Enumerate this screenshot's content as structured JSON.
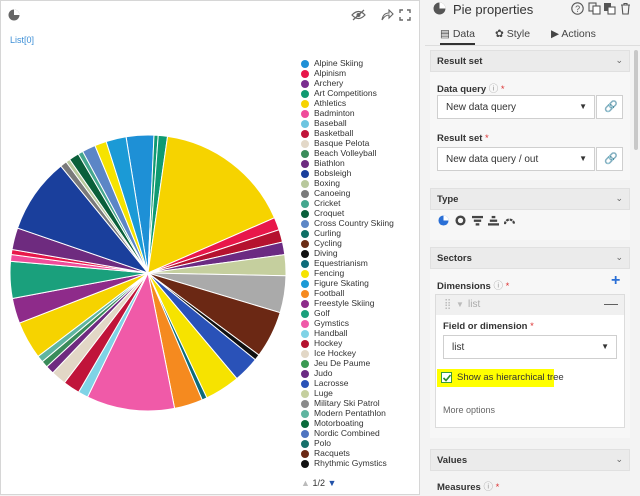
{
  "chart": {
    "list_label": "List[0]",
    "legend": [
      {
        "label": "Alpine Skiing",
        "color": "#1e90d6"
      },
      {
        "label": "Alpinism",
        "color": "#e8174a"
      },
      {
        "label": "Archery",
        "color": "#7b2d8f"
      },
      {
        "label": "Art Competitions",
        "color": "#0f9a72"
      },
      {
        "label": "Athletics",
        "color": "#f6d300"
      },
      {
        "label": "Badminton",
        "color": "#f04c9a"
      },
      {
        "label": "Baseball",
        "color": "#6cc5e0"
      },
      {
        "label": "Basketball",
        "color": "#c0143a"
      },
      {
        "label": "Basque Pelota",
        "color": "#e3d8c8"
      },
      {
        "label": "Beach Volleyball",
        "color": "#3a8c5a"
      },
      {
        "label": "Biathlon",
        "color": "#6e2b7f"
      },
      {
        "label": "Bobsleigh",
        "color": "#1a3f9c"
      },
      {
        "label": "Boxing",
        "color": "#b8c89c"
      },
      {
        "label": "Canoeing",
        "color": "#7a7a7a"
      },
      {
        "label": "Cricket",
        "color": "#44a78e"
      },
      {
        "label": "Croquet",
        "color": "#0a5f3a"
      },
      {
        "label": "Cross Country Skiing",
        "color": "#5c86c6"
      },
      {
        "label": "Curling",
        "color": "#0e6f66"
      },
      {
        "label": "Cycling",
        "color": "#6b2c14"
      },
      {
        "label": "Diving",
        "color": "#111111"
      },
      {
        "label": "Equestrianism",
        "color": "#0d6b7a"
      },
      {
        "label": "Fencing",
        "color": "#f6e300"
      },
      {
        "label": "Figure Skating",
        "color": "#1b9ad6"
      },
      {
        "label": "Football",
        "color": "#f58a1f"
      },
      {
        "label": "Freestyle Skiing",
        "color": "#8e2b8a"
      },
      {
        "label": "Golf",
        "color": "#1aa07c"
      },
      {
        "label": "Gymstics",
        "color": "#f05aa8"
      },
      {
        "label": "Handball",
        "color": "#7fd3e6"
      },
      {
        "label": "Hockey",
        "color": "#b5122f"
      },
      {
        "label": "Ice Hockey",
        "color": "#e2d7c6"
      },
      {
        "label": "Jeu De Paume",
        "color": "#3a9a52"
      },
      {
        "label": "Judo",
        "color": "#6b2a82"
      },
      {
        "label": "Lacrosse",
        "color": "#2a52b8"
      },
      {
        "label": "Luge",
        "color": "#c5cf9e"
      },
      {
        "label": "Military Ski Patrol",
        "color": "#8a8a8a"
      },
      {
        "label": "Modern Pentathlon",
        "color": "#5fb5a0"
      },
      {
        "label": "Motorboating",
        "color": "#0a6a3a"
      },
      {
        "label": "Nordic Combined",
        "color": "#4e74c0"
      },
      {
        "label": "Polo",
        "color": "#16706a"
      },
      {
        "label": "Racquets",
        "color": "#6b2814"
      },
      {
        "label": "Rhythmic Gymstics",
        "color": "#111111"
      }
    ],
    "slices": [
      {
        "color": "#1e90d6",
        "value": 3.3
      },
      {
        "color": "#0f9a72",
        "value": 0.5
      },
      {
        "color": "#0f9a72",
        "value": 1.1
      },
      {
        "color": "#f6d300",
        "value": 16.5
      },
      {
        "color": "#e8174a",
        "value": 1.5
      },
      {
        "color": "#b5122f",
        "value": 1.5
      },
      {
        "color": "#6b2a82",
        "value": 1.5
      },
      {
        "color": "#c5cf9e",
        "value": 2.5
      },
      {
        "color": "#aaaaaa",
        "value": 4.4
      },
      {
        "color": "#6b2814",
        "value": 5.6
      },
      {
        "color": "#111111",
        "value": 0.7
      },
      {
        "color": "#2a52b8",
        "value": 3.1
      },
      {
        "color": "#f6e300",
        "value": 4.2
      },
      {
        "color": "#0d6b7a",
        "value": 0.6
      },
      {
        "color": "#f58a1f",
        "value": 3.4
      },
      {
        "color": "#f05aa8",
        "value": 10.5
      },
      {
        "color": "#7fd3e6",
        "value": 1.2
      },
      {
        "color": "#c0143a",
        "value": 2.0
      },
      {
        "color": "#e2d7c6",
        "value": 1.8
      },
      {
        "color": "#6e2b7f",
        "value": 1.0
      },
      {
        "color": "#3a8c5a",
        "value": 0.8
      },
      {
        "color": "#5fb5a0",
        "value": 0.8
      },
      {
        "color": "#f6d300",
        "value": 4.5
      },
      {
        "color": "#8e2b8a",
        "value": 3.0
      },
      {
        "color": "#1aa07c",
        "value": 4.4
      },
      {
        "color": "#f04c9a",
        "value": 0.8
      },
      {
        "color": "#e8174a",
        "value": 0.6
      },
      {
        "color": "#6e2b7f",
        "value": 2.6
      },
      {
        "color": "#1a3f9c",
        "value": 9.0
      },
      {
        "color": "#7a7a7a",
        "value": 0.8
      },
      {
        "color": "#b8c89c",
        "value": 0.5
      },
      {
        "color": "#0a5f3a",
        "value": 1.2
      },
      {
        "color": "#44a78e",
        "value": 0.6
      },
      {
        "color": "#5c86c6",
        "value": 1.6
      },
      {
        "color": "#f6e300",
        "value": 1.4
      },
      {
        "color": "#1b9ad6",
        "value": 2.4
      }
    ],
    "pager": {
      "text": "1/2"
    }
  },
  "props": {
    "title": "Pie properties",
    "tabs": [
      "Data",
      "Style",
      "Actions"
    ],
    "sections": {
      "result_set": "Result set",
      "type": "Type",
      "sectors": "Sectors",
      "values": "Values"
    },
    "data_query_label": "Data query",
    "data_query_value": "New data query",
    "result_set_label": "Result set",
    "result_set_value": "New data query / out",
    "dimensions_label": "Dimensions",
    "dim_item": "list",
    "field_label": "Field or dimension",
    "field_value": "list",
    "checkbox_label": "Show as hierarchical tree",
    "more_options": "More options",
    "measures_label": "Measures",
    "highlight_color": "#ffff00",
    "accent_color": "#2a6fd6"
  }
}
